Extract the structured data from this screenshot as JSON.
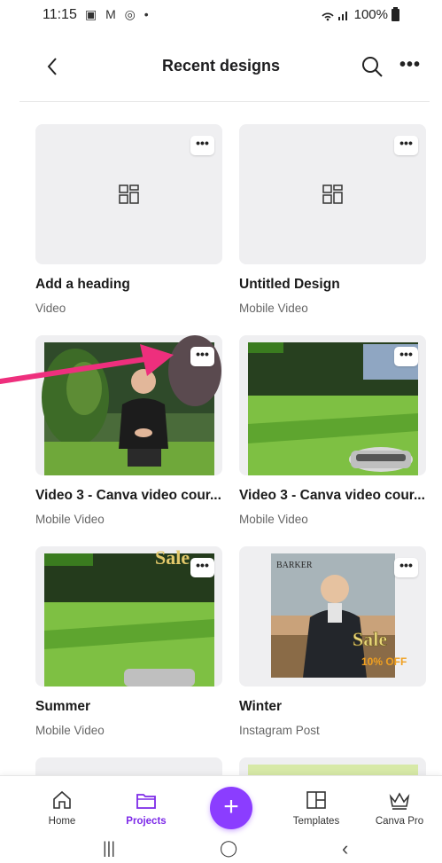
{
  "status": {
    "time": "11:15",
    "left_icons": "▣ M ◎ •",
    "right_text": "100%"
  },
  "header": {
    "title": "Recent designs",
    "back_icon": "chevron-left-icon",
    "search_icon": "search-icon",
    "more_icon": "more-icon",
    "more_glyph": "•••",
    "back_glyph": "‹"
  },
  "cards": [
    {
      "title": "Add a heading",
      "subtitle": "Video",
      "thumb": "placeholder"
    },
    {
      "title": "Untitled Design",
      "subtitle": "Mobile Video",
      "thumb": "placeholder"
    },
    {
      "title": "Video 3 - Canva video cour...",
      "subtitle": "Mobile Video",
      "thumb": "man-garden"
    },
    {
      "title": "Video 3 - Canva video cour...",
      "subtitle": "Mobile Video",
      "thumb": "lawn-mower"
    },
    {
      "title": "Summer",
      "subtitle": "Mobile Video",
      "thumb": "lawn-sale"
    },
    {
      "title": "Winter",
      "subtitle": "Instagram Post",
      "thumb": "barker-sale"
    }
  ],
  "card_menu_glyph": "•••",
  "thumb_text": {
    "barker_brand": "BARKER",
    "sale_word": "Sale",
    "discount": "10% OFF"
  },
  "nav": {
    "home": "Home",
    "projects": "Projects",
    "create": "+",
    "templates": "Templates",
    "canva_pro": "Canva Pro"
  },
  "system_nav": {
    "recents": "|||",
    "home": "◯",
    "back": "‹"
  },
  "colors": {
    "accent": "#8b3dff",
    "active_nav": "#7d2ae8",
    "annotation_arrow": "#ee2f7d"
  }
}
